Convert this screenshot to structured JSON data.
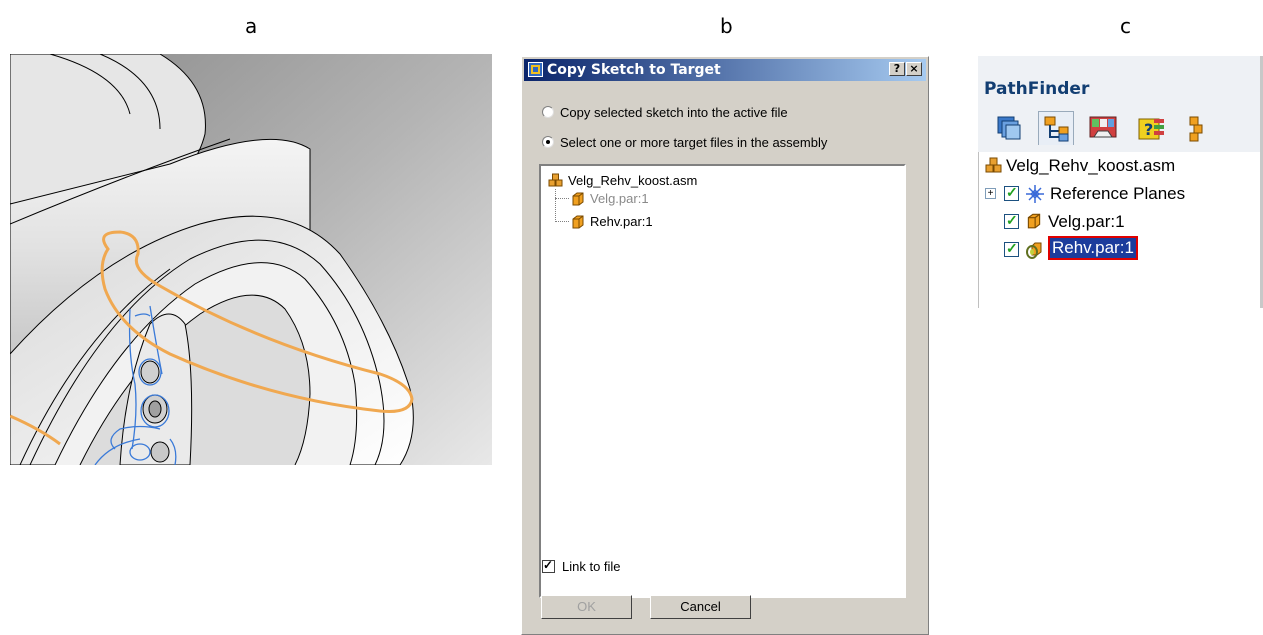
{
  "panel_letters": [
    "a",
    "b",
    "c"
  ],
  "dialog": {
    "title": "Copy Sketch to Target",
    "help_button": "?",
    "close_button": "×",
    "radio_options": [
      {
        "label": "Copy selected sketch into the active file",
        "selected": false
      },
      {
        "label": "Select one or more target files in the assembly",
        "selected": true
      }
    ],
    "tree": {
      "root": "Velg_Rehv_koost.asm",
      "children": [
        {
          "label": "Velg.par:1",
          "disabled": true
        },
        {
          "label": "Rehv.par:1",
          "disabled": false
        }
      ]
    },
    "link_to_file": {
      "label": "Link to file",
      "checked": true
    },
    "ok_label": "OK",
    "cancel_label": "Cancel"
  },
  "pathfinder": {
    "title": "PathFinder",
    "tabs": [
      "assembly-tab",
      "tree-tab",
      "simplify-tab",
      "query-tab",
      "layers-tab"
    ],
    "tree": {
      "root": "Velg_Rehv_koost.asm",
      "items": [
        {
          "label": "Reference Planes",
          "checked": true,
          "expandable": true
        },
        {
          "label": "Velg.par:1",
          "checked": true
        },
        {
          "label": "Rehv.par:1",
          "checked": true,
          "selected": true
        }
      ],
      "expander_symbol": "+"
    }
  },
  "colors": {
    "titlebar_start": "#0a246a",
    "titlebar_end": "#a6caf0",
    "dialog_bg": "#d4d0c8",
    "sketch_orange": "#f0a850",
    "sketch_blue": "#3a7ad8",
    "selection_border": "#e00000",
    "pathfinder_title": "#123e72"
  }
}
